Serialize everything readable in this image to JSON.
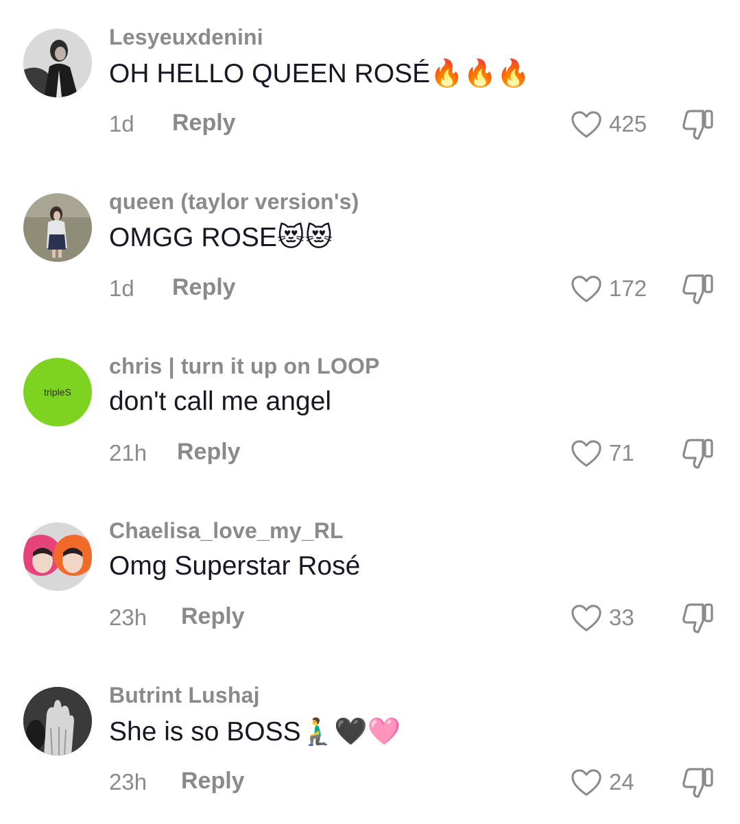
{
  "comments": [
    {
      "username": "Lesyeuxdenini",
      "text": "OH HELLO QUEEN ROSÉ🔥🔥🔥",
      "time": "1d",
      "reply_label": "Reply",
      "likes": "425",
      "avatar_icon": "avatar-photo-person-dark"
    },
    {
      "username": "queen (taylor version's)",
      "text": "OMGG ROSE😻😻",
      "time": "1d",
      "reply_label": "Reply",
      "likes": "172",
      "avatar_icon": "avatar-photo-person-field"
    },
    {
      "username": "chris | turn it up on LOOP",
      "text": "don't call me angel",
      "time": "21h",
      "reply_label": "Reply",
      "likes": "71",
      "avatar_text": "tripleS",
      "avatar_color": "#7ed321"
    },
    {
      "username": "Chaelisa_love_my_RL",
      "text": "Omg Superstar Rosé",
      "time": "23h",
      "reply_label": "Reply",
      "likes": "33",
      "avatar_icon": "avatar-photo-two-people-hoodies"
    },
    {
      "username": "Butrint Lushaj",
      "text": "She is so BOSS🧎‍♂️🖤🩷",
      "time": "23h",
      "reply_label": "Reply",
      "likes": "24",
      "avatar_icon": "avatar-photo-hand-dark"
    }
  ],
  "colors": {
    "secondary_text": "#8a8a8a",
    "primary_text": "#161823"
  },
  "icons": {
    "like": "heart-outline-icon",
    "dislike": "thumbs-down-outline-icon"
  }
}
